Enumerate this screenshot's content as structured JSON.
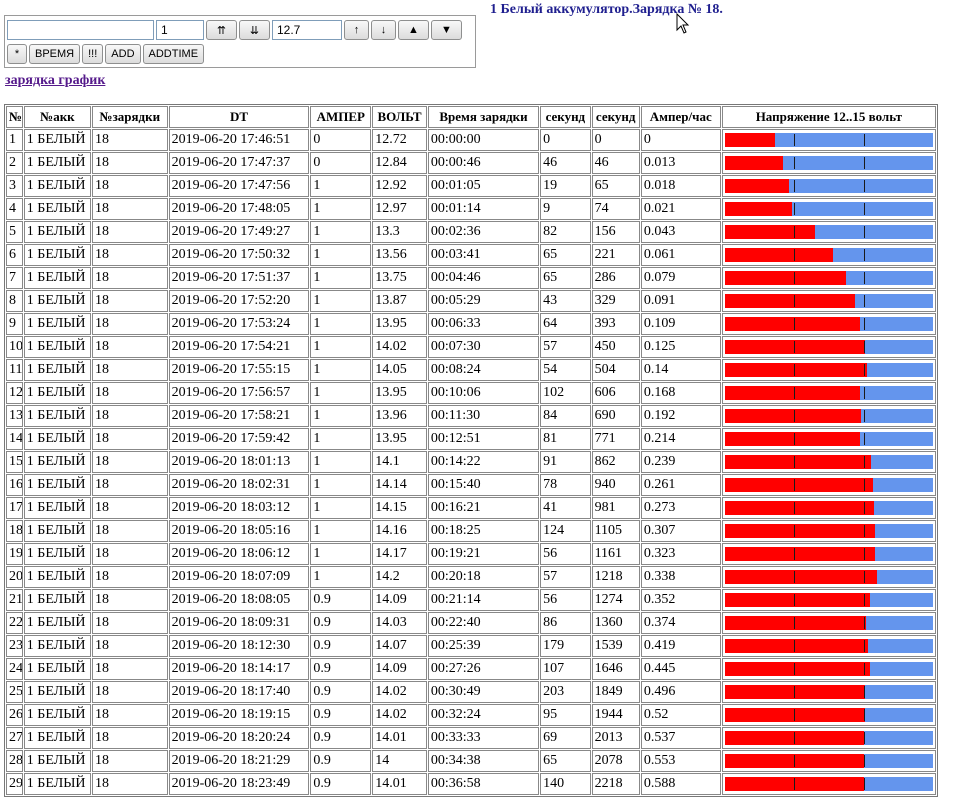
{
  "title": "1 Белый аккумулятор.Зарядка № 18.",
  "link_label": "зарядка график",
  "controls": {
    "input1_value": "",
    "input2_value": "1",
    "btn_up2": "⇈",
    "btn_down2": "⇊",
    "input3_value": "12.7",
    "btn_up": "↑",
    "btn_down": "↓",
    "btn_tri_up": "▲",
    "btn_tri_down": "▼",
    "btn_star": "*",
    "btn_time": "ВРЕМЯ",
    "btn_excl": "!!!",
    "btn_add": "ADD",
    "btn_addtime": "ADDTIME"
  },
  "table": {
    "headers": [
      "№",
      "№акк",
      "№зарядки",
      "DT",
      "АМПЕР",
      "ВОЛЬТ",
      "Время зарядки",
      "секунд",
      "секунд",
      "Ампер/час",
      "Напряжение 12..15 вольт"
    ],
    "voltage_scale": [
      12,
      15
    ],
    "rows": [
      [
        "1",
        "1 БЕЛЫЙ",
        "18",
        "2019-06-20 17:46:51",
        "0",
        "12.72",
        "00:00:00",
        "0",
        "0",
        "0"
      ],
      [
        "2",
        "1 БЕЛЫЙ",
        "18",
        "2019-06-20 17:47:37",
        "0",
        "12.84",
        "00:00:46",
        "46",
        "46",
        "0.013"
      ],
      [
        "3",
        "1 БЕЛЫЙ",
        "18",
        "2019-06-20 17:47:56",
        "1",
        "12.92",
        "00:01:05",
        "19",
        "65",
        "0.018"
      ],
      [
        "4",
        "1 БЕЛЫЙ",
        "18",
        "2019-06-20 17:48:05",
        "1",
        "12.97",
        "00:01:14",
        "9",
        "74",
        "0.021"
      ],
      [
        "5",
        "1 БЕЛЫЙ",
        "18",
        "2019-06-20 17:49:27",
        "1",
        "13.3",
        "00:02:36",
        "82",
        "156",
        "0.043"
      ],
      [
        "6",
        "1 БЕЛЫЙ",
        "18",
        "2019-06-20 17:50:32",
        "1",
        "13.56",
        "00:03:41",
        "65",
        "221",
        "0.061"
      ],
      [
        "7",
        "1 БЕЛЫЙ",
        "18",
        "2019-06-20 17:51:37",
        "1",
        "13.75",
        "00:04:46",
        "65",
        "286",
        "0.079"
      ],
      [
        "8",
        "1 БЕЛЫЙ",
        "18",
        "2019-06-20 17:52:20",
        "1",
        "13.87",
        "00:05:29",
        "43",
        "329",
        "0.091"
      ],
      [
        "9",
        "1 БЕЛЫЙ",
        "18",
        "2019-06-20 17:53:24",
        "1",
        "13.95",
        "00:06:33",
        "64",
        "393",
        "0.109"
      ],
      [
        "10",
        "1 БЕЛЫЙ",
        "18",
        "2019-06-20 17:54:21",
        "1",
        "14.02",
        "00:07:30",
        "57",
        "450",
        "0.125"
      ],
      [
        "11",
        "1 БЕЛЫЙ",
        "18",
        "2019-06-20 17:55:15",
        "1",
        "14.05",
        "00:08:24",
        "54",
        "504",
        "0.14"
      ],
      [
        "12",
        "1 БЕЛЫЙ",
        "18",
        "2019-06-20 17:56:57",
        "1",
        "13.95",
        "00:10:06",
        "102",
        "606",
        "0.168"
      ],
      [
        "13",
        "1 БЕЛЫЙ",
        "18",
        "2019-06-20 17:58:21",
        "1",
        "13.96",
        "00:11:30",
        "84",
        "690",
        "0.192"
      ],
      [
        "14",
        "1 БЕЛЫЙ",
        "18",
        "2019-06-20 17:59:42",
        "1",
        "13.95",
        "00:12:51",
        "81",
        "771",
        "0.214"
      ],
      [
        "15",
        "1 БЕЛЫЙ",
        "18",
        "2019-06-20 18:01:13",
        "1",
        "14.1",
        "00:14:22",
        "91",
        "862",
        "0.239"
      ],
      [
        "16",
        "1 БЕЛЫЙ",
        "18",
        "2019-06-20 18:02:31",
        "1",
        "14.14",
        "00:15:40",
        "78",
        "940",
        "0.261"
      ],
      [
        "17",
        "1 БЕЛЫЙ",
        "18",
        "2019-06-20 18:03:12",
        "1",
        "14.15",
        "00:16:21",
        "41",
        "981",
        "0.273"
      ],
      [
        "18",
        "1 БЕЛЫЙ",
        "18",
        "2019-06-20 18:05:16",
        "1",
        "14.16",
        "00:18:25",
        "124",
        "1105",
        "0.307"
      ],
      [
        "19",
        "1 БЕЛЫЙ",
        "18",
        "2019-06-20 18:06:12",
        "1",
        "14.17",
        "00:19:21",
        "56",
        "1161",
        "0.323"
      ],
      [
        "20",
        "1 БЕЛЫЙ",
        "18",
        "2019-06-20 18:07:09",
        "1",
        "14.2",
        "00:20:18",
        "57",
        "1218",
        "0.338"
      ],
      [
        "21",
        "1 БЕЛЫЙ",
        "18",
        "2019-06-20 18:08:05",
        "0.9",
        "14.09",
        "00:21:14",
        "56",
        "1274",
        "0.352"
      ],
      [
        "22",
        "1 БЕЛЫЙ",
        "18",
        "2019-06-20 18:09:31",
        "0.9",
        "14.03",
        "00:22:40",
        "86",
        "1360",
        "0.374"
      ],
      [
        "23",
        "1 БЕЛЫЙ",
        "18",
        "2019-06-20 18:12:30",
        "0.9",
        "14.07",
        "00:25:39",
        "179",
        "1539",
        "0.419"
      ],
      [
        "24",
        "1 БЕЛЫЙ",
        "18",
        "2019-06-20 18:14:17",
        "0.9",
        "14.09",
        "00:27:26",
        "107",
        "1646",
        "0.445"
      ],
      [
        "25",
        "1 БЕЛЫЙ",
        "18",
        "2019-06-20 18:17:40",
        "0.9",
        "14.02",
        "00:30:49",
        "203",
        "1849",
        "0.496"
      ],
      [
        "26",
        "1 БЕЛЫЙ",
        "18",
        "2019-06-20 18:19:15",
        "0.9",
        "14.02",
        "00:32:24",
        "95",
        "1944",
        "0.52"
      ],
      [
        "27",
        "1 БЕЛЫЙ",
        "18",
        "2019-06-20 18:20:24",
        "0.9",
        "14.01",
        "00:33:33",
        "69",
        "2013",
        "0.537"
      ],
      [
        "28",
        "1 БЕЛЫЙ",
        "18",
        "2019-06-20 18:21:29",
        "0.9",
        "14",
        "00:34:38",
        "65",
        "2078",
        "0.553"
      ],
      [
        "29",
        "1 БЕЛЫЙ",
        "18",
        "2019-06-20 18:23:49",
        "0.9",
        "14.01",
        "00:36:58",
        "140",
        "2218",
        "0.588"
      ]
    ]
  },
  "colors": {
    "bar_fill": "#ff0000",
    "bar_track": "#6495ed",
    "title": "#1f1f8f",
    "link": "#551a8b"
  },
  "icons": {
    "cursor": "mouse-pointer-icon"
  }
}
